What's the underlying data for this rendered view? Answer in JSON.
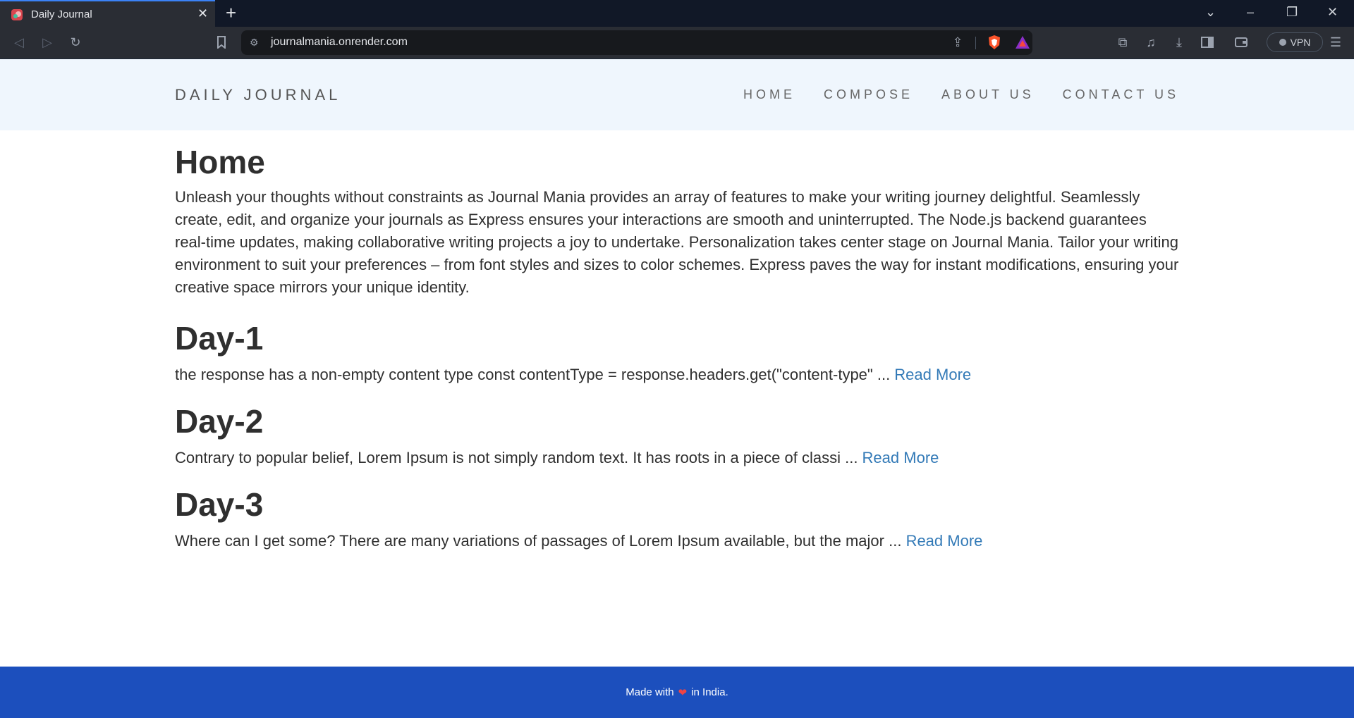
{
  "browser": {
    "tab_title": "Daily Journal",
    "url": "journalmania.onrender.com",
    "vpn_label": "VPN",
    "icons": {
      "back": "back-icon",
      "forward": "forward-icon",
      "reload": "reload-icon",
      "bookmark": "bookmark-icon",
      "share": "share-icon",
      "extensions": "puzzle-icon",
      "media": "music-icon",
      "downloads": "download-icon",
      "sidebar": "sidebar-icon",
      "wallet": "wallet-icon",
      "menu": "hamburger-icon"
    }
  },
  "site": {
    "brand": "DAILY JOURNAL",
    "nav": [
      "HOME",
      "COMPOSE",
      "ABOUT US",
      "CONTACT US"
    ]
  },
  "home": {
    "heading": "Home",
    "intro": "Unleash your thoughts without constraints as Journal Mania provides an array of features to make your writing journey delightful. Seamlessly create, edit, and organize your journals as Express ensures your interactions are smooth and uninterrupted. The Node.js backend guarantees real-time updates, making collaborative writing projects a joy to undertake. Personalization takes center stage on Journal Mania. Tailor your writing environment to suit your preferences – from font styles and sizes to color schemes. Express paves the way for instant modifications, ensuring your creative space mirrors your unique identity."
  },
  "posts": [
    {
      "title": "Day-1",
      "excerpt": "the response has a non-empty content type const contentType = response.headers.get(\"content-type\" ... ",
      "read_more": "Read More"
    },
    {
      "title": "Day-2",
      "excerpt": "Contrary to popular belief, Lorem Ipsum is not simply random text. It has roots in a piece of classi ... ",
      "read_more": "Read More"
    },
    {
      "title": "Day-3",
      "excerpt": "Where can I get some? There are many variations of passages of Lorem Ipsum available, but the major ... ",
      "read_more": "Read More"
    }
  ],
  "footer": {
    "before": "Made with",
    "heart": "❤",
    "after": "in India."
  },
  "colors": {
    "header_bg": "#eff6fd",
    "footer_bg": "#1c4fbd",
    "link": "#337ab7"
  }
}
